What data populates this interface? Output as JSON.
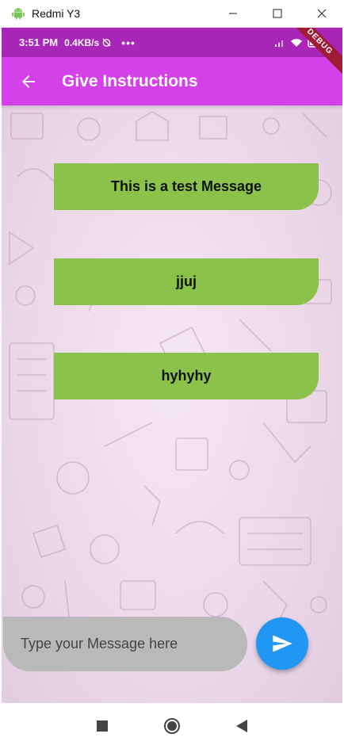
{
  "window": {
    "title": "Redmi Y3",
    "controls": [
      "minimize-icon",
      "maximize-icon",
      "close-icon"
    ]
  },
  "status_bar": {
    "time": "3:51 PM",
    "speed": "0.4KB/s",
    "more": "•••",
    "icons": [
      "alarm-off-icon",
      "signal-icon",
      "wifi-icon",
      "battery-icon"
    ],
    "debug_label": "DEBUG"
  },
  "app_bar": {
    "title": "Give Instructions",
    "back_icon": "arrow-back-icon"
  },
  "messages": [
    {
      "text": "This is a test Message"
    },
    {
      "text": "jjuj"
    },
    {
      "text": "hyhyhy"
    }
  ],
  "composer": {
    "placeholder": "Type your Message here",
    "send_icon": "send-icon"
  },
  "nav_bar": {
    "buttons": [
      "recents-square-icon",
      "home-circle-icon",
      "back-triangle-icon"
    ]
  },
  "colors": {
    "status_bar": "#a826b8",
    "app_bar": "#d541e8",
    "bubble": "#8bc34a",
    "input": "#b8b9b8",
    "send": "#2196f3"
  }
}
